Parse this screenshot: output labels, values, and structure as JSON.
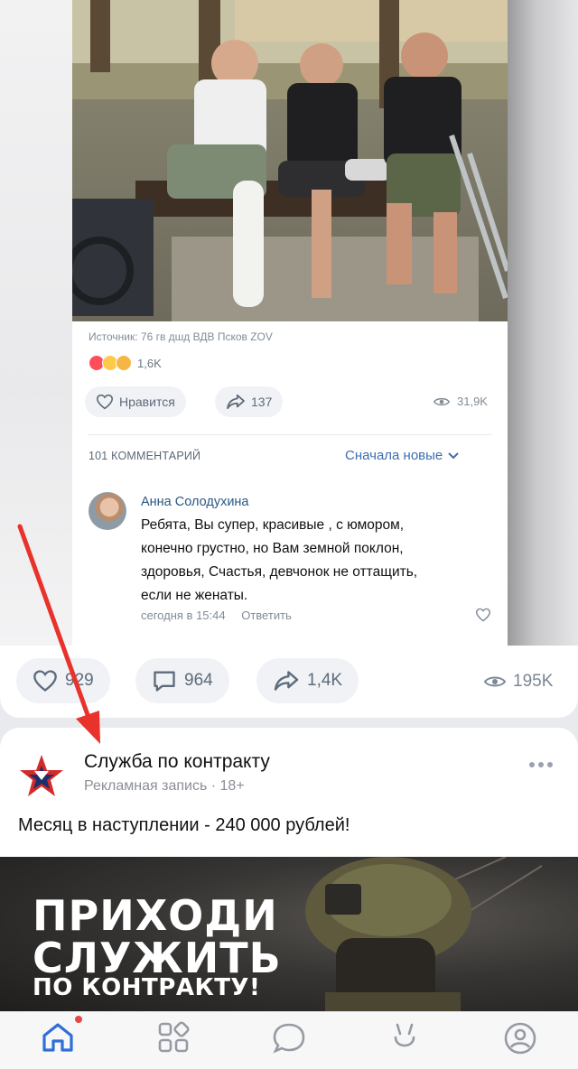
{
  "embedded_post": {
    "source": "Источник: 76 гв дшд ВДВ Псков ZOV",
    "reactions_count": "1,6K",
    "like_label": "Нравится",
    "share_count": "137",
    "views": "31,9K",
    "comments_count": "101 КОММЕНТАРИЙ",
    "sort_label": "Сначала новые",
    "comment": {
      "author": "Анна Солодухина",
      "lines": [
        "Ребята, Вы супер, красивые , с юмором,",
        "конечно грустно, но Вам земной поклон,",
        "здоровья, Счастья, девчонок не оттащить,",
        "если не женаты."
      ],
      "time": "сегодня в 15:44",
      "reply_label": "Ответить"
    }
  },
  "post_actions": {
    "likes": "929",
    "comments": "964",
    "shares": "1,4K",
    "views": "195K"
  },
  "ad_post": {
    "title": "Служба по контракту",
    "subtitle": "Рекламная запись · 18+",
    "text": "Месяц в наступлении - 240 000 рублей!",
    "banner_lines": [
      "ПРИХОДИ",
      "СЛУЖИТЬ",
      "ПО КОНТРАКТУ!"
    ]
  },
  "colors": {
    "accent": "#2f6fd6",
    "link": "#3e6fb0",
    "arrow": "#e8322b",
    "notification_dot": "#e64646"
  },
  "tabbar": {
    "items": [
      {
        "icon": "home-icon",
        "active": true
      },
      {
        "icon": "services-icon",
        "active": false
      },
      {
        "icon": "messenger-icon",
        "active": false
      },
      {
        "icon": "clips-icon",
        "active": false
      },
      {
        "icon": "profile-icon",
        "active": false
      }
    ]
  }
}
